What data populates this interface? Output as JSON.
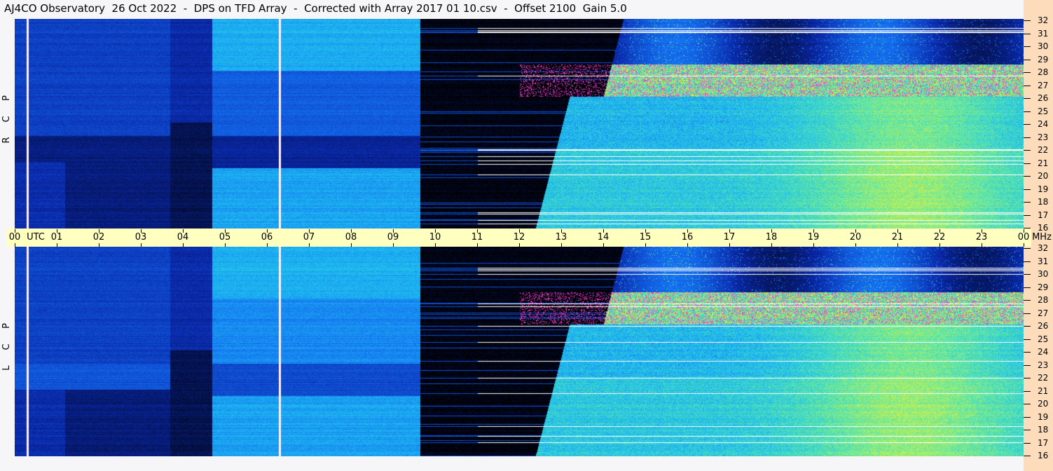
{
  "title": "AJ4CO Observatory  26 Oct 2022  -  DPS on TFD Array  -  Corrected with Array 2017 01 10.csv  -  Offset 2100  Gain 5.0",
  "colors": {
    "time_bar": "#ffffc0",
    "axis_panel": "#fddcbc"
  },
  "chart_data": [
    {
      "type": "heatmap",
      "name": "RCP",
      "panel_label": [
        "R",
        "C",
        "P"
      ],
      "xlabel": "UTC",
      "ylabel": "MHz",
      "x_range_hours": [
        0,
        24
      ],
      "y_range_mhz": [
        16,
        32
      ]
    },
    {
      "type": "heatmap",
      "name": "LCP",
      "panel_label": [
        "L",
        "C",
        "P"
      ],
      "xlabel": "UTC",
      "ylabel": "MHz",
      "x_range_hours": [
        0,
        24
      ],
      "y_range_mhz": [
        16,
        32
      ]
    }
  ],
  "axis": {
    "utc_label": "UTC",
    "mhz_label": "MHz",
    "hour_ticks": [
      "00",
      "01",
      "02",
      "03",
      "04",
      "05",
      "06",
      "07",
      "08",
      "09",
      "10",
      "11",
      "12",
      "13",
      "14",
      "15",
      "16",
      "17",
      "18",
      "19",
      "20",
      "21",
      "22",
      "23",
      "00"
    ],
    "freq_ticks": [
      "32",
      "31",
      "30",
      "29",
      "28",
      "27",
      "26",
      "25",
      "24",
      "23",
      "22",
      "21",
      "20",
      "19",
      "18",
      "17",
      "16"
    ]
  }
}
